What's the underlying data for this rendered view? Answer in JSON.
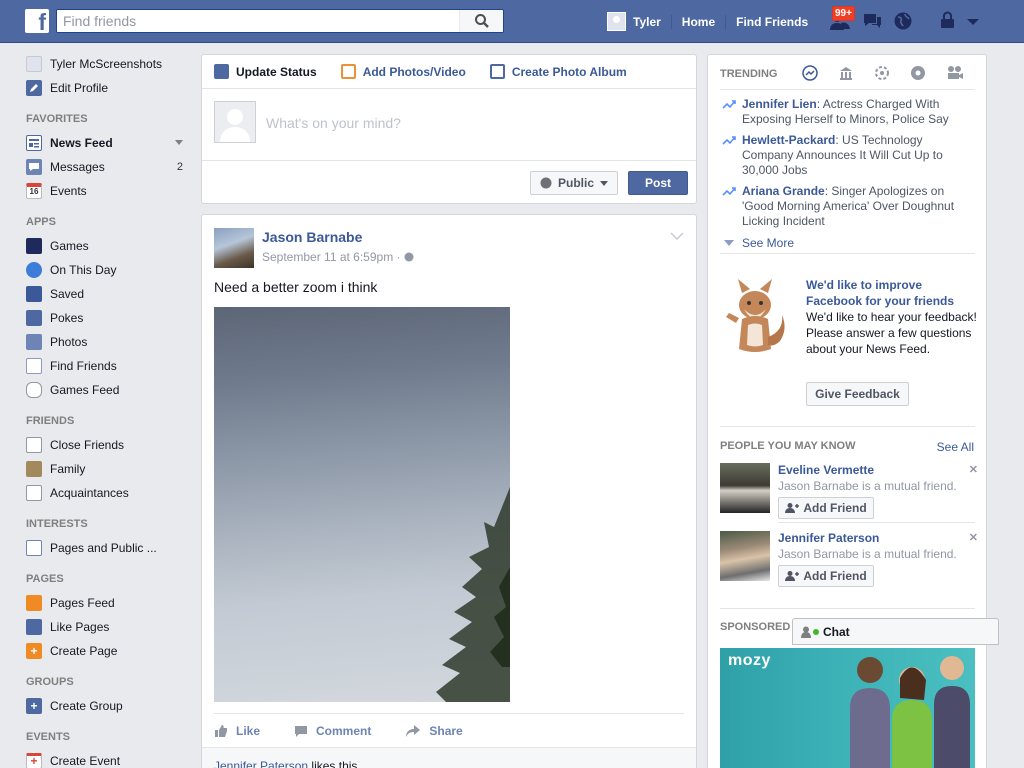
{
  "topbar": {
    "search_placeholder": "Find friends",
    "user": "Tyler",
    "home": "Home",
    "find_friends": "Find Friends",
    "friend_requests_badge": "99+"
  },
  "sidebar": {
    "profile": [
      {
        "label": "Tyler McScreenshots",
        "icon": "profile-photo"
      },
      {
        "label": "Edit Profile",
        "icon": "pencil-icon"
      }
    ],
    "sections": [
      {
        "title": "FAVORITES",
        "items": [
          {
            "label": "News Feed",
            "icon": "news-feed-icon",
            "bold": true,
            "caret": true
          },
          {
            "label": "Messages",
            "icon": "messages-icon",
            "count": "2"
          },
          {
            "label": "Events",
            "icon": "calendar-icon",
            "icon_text": "16"
          }
        ]
      },
      {
        "title": "APPS",
        "items": [
          {
            "label": "Games",
            "icon": "games-icon"
          },
          {
            "label": "On This Day",
            "icon": "clock-icon"
          },
          {
            "label": "Saved",
            "icon": "bookmark-icon"
          },
          {
            "label": "Pokes",
            "icon": "poke-icon"
          },
          {
            "label": "Photos",
            "icon": "photos-icon"
          },
          {
            "label": "Find Friends",
            "icon": "find-friends-icon"
          },
          {
            "label": "Games Feed",
            "icon": "gamepad-icon"
          }
        ]
      },
      {
        "title": "FRIENDS",
        "items": [
          {
            "label": "Close Friends",
            "icon": "star-icon"
          },
          {
            "label": "Family",
            "icon": "house-icon"
          },
          {
            "label": "Acquaintances",
            "icon": "people-icon"
          }
        ]
      },
      {
        "title": "INTERESTS",
        "items": [
          {
            "label": "Pages and Public ...",
            "icon": "list-icon"
          }
        ]
      },
      {
        "title": "PAGES",
        "items": [
          {
            "label": "Pages Feed",
            "icon": "flag-icon"
          },
          {
            "label": "Like Pages",
            "icon": "thumbs-up-icon"
          },
          {
            "label": "Create Page",
            "icon": "plus-icon"
          }
        ]
      },
      {
        "title": "GROUPS",
        "items": [
          {
            "label": "Create Group",
            "icon": "plus-icon"
          }
        ]
      },
      {
        "title": "EVENTS",
        "items": [
          {
            "label": "Create Event",
            "icon": "plus-icon"
          }
        ]
      }
    ]
  },
  "composer": {
    "tabs": [
      "Update Status",
      "Add Photos/Video",
      "Create Photo Album"
    ],
    "placeholder": "What's on your mind?",
    "audience": "Public",
    "post_label": "Post"
  },
  "story": {
    "author": "Jason Barnabe",
    "time": "September 11 at 6:59pm",
    "message": "Need a better zoom i think",
    "actions": [
      "Like",
      "Comment",
      "Share"
    ],
    "liker": "Jennifer Paterson",
    "likes_suffix": "likes this."
  },
  "trending": {
    "title": "TRENDING",
    "items": [
      {
        "topic": "Jennifer Lien",
        "text": "Actress Charged With Exposing Herself to Minors, Police Say"
      },
      {
        "topic": "Hewlett-Packard",
        "text": "US Technology Company Announces It Will Cut Up to 30,000 Jobs"
      },
      {
        "topic": "Ariana Grande",
        "text": "Singer Apologizes on 'Good Morning America' Over Doughnut Licking Incident"
      }
    ],
    "see_more": "See More"
  },
  "feedback": {
    "title": "We'd like to improve Facebook for your friends",
    "body": "We'd like to hear your feedback! Please answer a few questions about your News Feed.",
    "button": "Give Feedback"
  },
  "pymk": {
    "title": "PEOPLE YOU MAY KNOW",
    "see_all": "See All",
    "people": [
      {
        "name": "Eveline Vermette",
        "mutual": "Jason Barnabe is a mutual friend.",
        "button": "Add Friend"
      },
      {
        "name": "Jennifer Paterson",
        "mutual": "Jason Barnabe is a mutual friend.",
        "button": "Add Friend"
      }
    ]
  },
  "sponsored": {
    "title": "SPONSORED",
    "brand": "mozy"
  },
  "chat": {
    "label": "Chat"
  },
  "colors": {
    "brand_blue": "#4e69a2",
    "link": "#3b5998",
    "badge_red": "#f03d25"
  }
}
